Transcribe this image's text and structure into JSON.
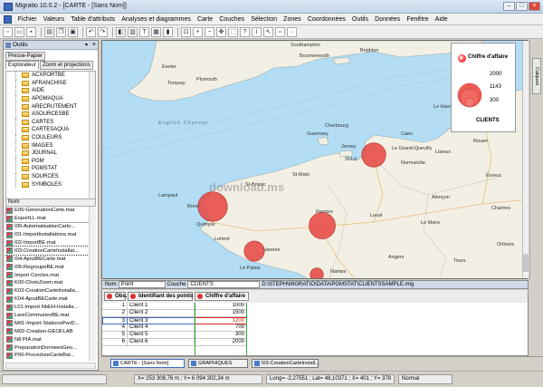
{
  "window": {
    "title": "Migratio 10.0.2 - [CARTE - [Sans Nom]]",
    "min": "–",
    "max": "□",
    "close": "×"
  },
  "menu": [
    "Fichier",
    "Valeurs",
    "Table d'attributs",
    "Analyses et diagrammes",
    "Carte",
    "Couches",
    "Sélection",
    "Zones",
    "Coordonnées",
    "Outils",
    "Données",
    "Fenêtre",
    "Aide"
  ],
  "toolbar": [
    "new-file-icon",
    "open-icon",
    "save-icon",
    "print-icon",
    "copy-icon",
    "paste-icon",
    "undo-icon",
    "redo-icon",
    "layers-icon",
    "layout-icon",
    "text-icon",
    "table-icon",
    "chart-icon",
    "zoom-window-icon",
    "zoom-in-icon",
    "zoom-out-icon",
    "pan-icon",
    "select-icon",
    "query-icon",
    "info-icon",
    "arrow-icon",
    "measure-icon",
    "lasso-icon"
  ],
  "outils": {
    "title": "Outils",
    "tabs": [
      "Presse-Papier",
      "Explorateur",
      "Zoom et projections"
    ],
    "tree": [
      "ACXPORTBE",
      "AFRANCHISE",
      "AIDE",
      "APGMAQUA",
      "ARECRUTEMENT",
      "ASOURCESBE",
      "CARTES",
      "CARTESAQUA",
      "COULEURS",
      "IMAGES",
      "JOURNAL",
      "PGM",
      "PGMSTAT",
      "SOURCES",
      "SYMBOLES"
    ],
    "files_header": "Nom",
    "files": [
      "E05-GenerationCarte.mat",
      "ExportLL.mat",
      "I00-AutomatisationCarto...",
      "I01-ImportInstallations.mat",
      "I02-ImportBE.mat",
      "I03-CreationCarteInstallat...",
      "I04-AjoutBECarte.mat",
      "I05-RegroupeBE.mat",
      "Import Cercles.mat",
      "K00-ChoixZoom.mat",
      "K03-CreationCarteInstalla...",
      "K04-AjoutBECarte.mat",
      "L01-Import NbEH-Installa...",
      "LareCommunesBE.mat",
      "M01-Import-StationsPwrD...",
      "M02-Creation-GEOFLAB",
      "N8 PIA.mat",
      "PreparationDonneesGeo...",
      "P00-ProcedureCarteBat..."
    ]
  },
  "map": {
    "labels": {
      "southampton": "Southampton",
      "brighton": "Brighton",
      "bournemouth": "Bournemouth",
      "exeter": "Exeter",
      "plymouth": "Plymouth",
      "channel": "English Channel",
      "torquay": "Torquay",
      "cherbourg": "Cherbourg",
      "le_havre": "Le Havre",
      "caen": "Caen",
      "evreux": "Évreux",
      "rouen": "Rouen",
      "st_lo": "St-Lô",
      "lisieux": "Lisieux",
      "normandie": "Normandie",
      "grand_quevilly": "Le Grand-Quevilly",
      "alencon": "Alençon",
      "chartres": "Chartres",
      "st_malo": "St-Malo",
      "rennes": "Rennes",
      "laval": "Laval",
      "le_mans": "Le Mans",
      "brest": "Brest",
      "quimper": "Quimper",
      "vannes": "Vannes",
      "lorient": "Lorient",
      "st_brieuc": "St-Brieuc",
      "lampaul": "Lampaul",
      "nantes": "Nantes",
      "angers": "Angers",
      "tours": "Tours",
      "orleans": "Orléans",
      "le_palais": "Le Palais",
      "guernsey": "Guernsey",
      "jersey": "Jersey",
      "watermark": "download.ms"
    }
  },
  "legend": {
    "title": "Chiffre d'affaire",
    "values": [
      "2000",
      "1143",
      "300"
    ],
    "unit": "CLIENTS"
  },
  "side_tab": "Calques",
  "datatable": {
    "nom_label": "Nom",
    "nom_value": "Point",
    "couche_label": "Couche",
    "couche_value": "CLIENTS",
    "path": "D:\\STEPH\\MIGRATIO\\DATA\\PGMSTAT\\CLIENTSSAMPLE.mig",
    "columns": [
      "Obs.",
      "Identifiant des points",
      "Chiffre d'affaire"
    ],
    "rows": [
      [
        "1",
        "Client 1",
        "1000"
      ],
      [
        "2",
        "Client 2",
        "1500"
      ],
      [
        "3",
        "Client 3",
        "1200"
      ],
      [
        "4",
        "Client 4",
        "700"
      ],
      [
        "5",
        "Client 5",
        "300"
      ],
      [
        "6",
        "Client 6",
        "2000"
      ]
    ]
  },
  "taskbar": [
    "CARTE - [Sans Nom]",
    "GRAPHIQUES",
    "I03-CreationCarteInstall..."
  ],
  "status": {
    "xy": "X= 253 308,76 m ; Y= 6 094 302,34 m",
    "longlat": "Long= -2,27551 ; Lat= 48,10371 ; X= 401 ; Y= 378",
    "mode": "Normal"
  },
  "colors": {
    "bubble": "#e8443f",
    "sea": "#b3ddf5",
    "land": "#f2efe4",
    "grid_selected": "#d22"
  }
}
